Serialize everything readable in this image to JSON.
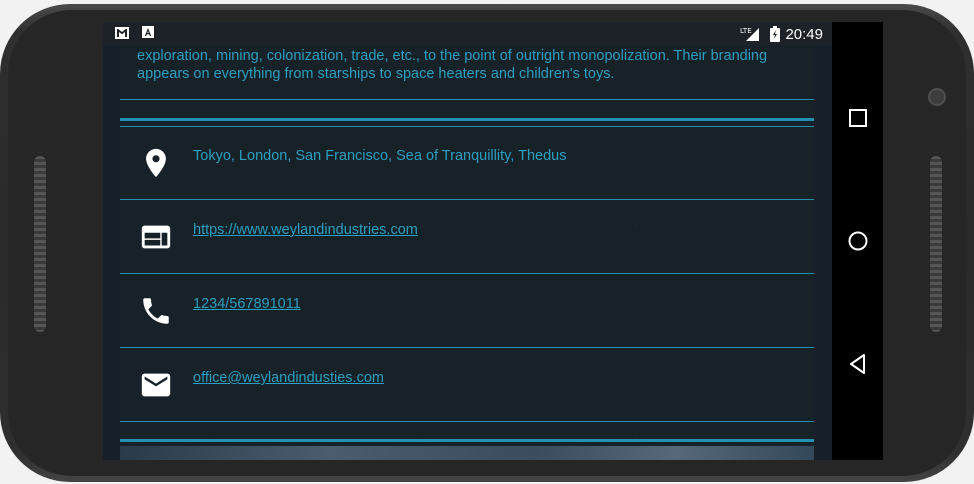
{
  "status": {
    "time": "20:49",
    "network": "LTE"
  },
  "description": "exploration, mining, colonization, trade, etc., to the point of outright monopolization. Their branding appears on everything from starships to space heaters and children's toys.",
  "details": [
    {
      "icon": "location-pin-icon",
      "text": "Tokyo, London, San Francisco, Sea of Tranquillity, Thedus"
    },
    {
      "icon": "web-icon",
      "text": "https://www.weylandindustries.com"
    },
    {
      "icon": "phone-icon",
      "text": "1234/567891011"
    },
    {
      "icon": "mail-icon",
      "text": "office@weylandindusties.com"
    }
  ],
  "colors": {
    "accent": "#2a9fc0",
    "background": "#16202a",
    "card": "#182228"
  }
}
